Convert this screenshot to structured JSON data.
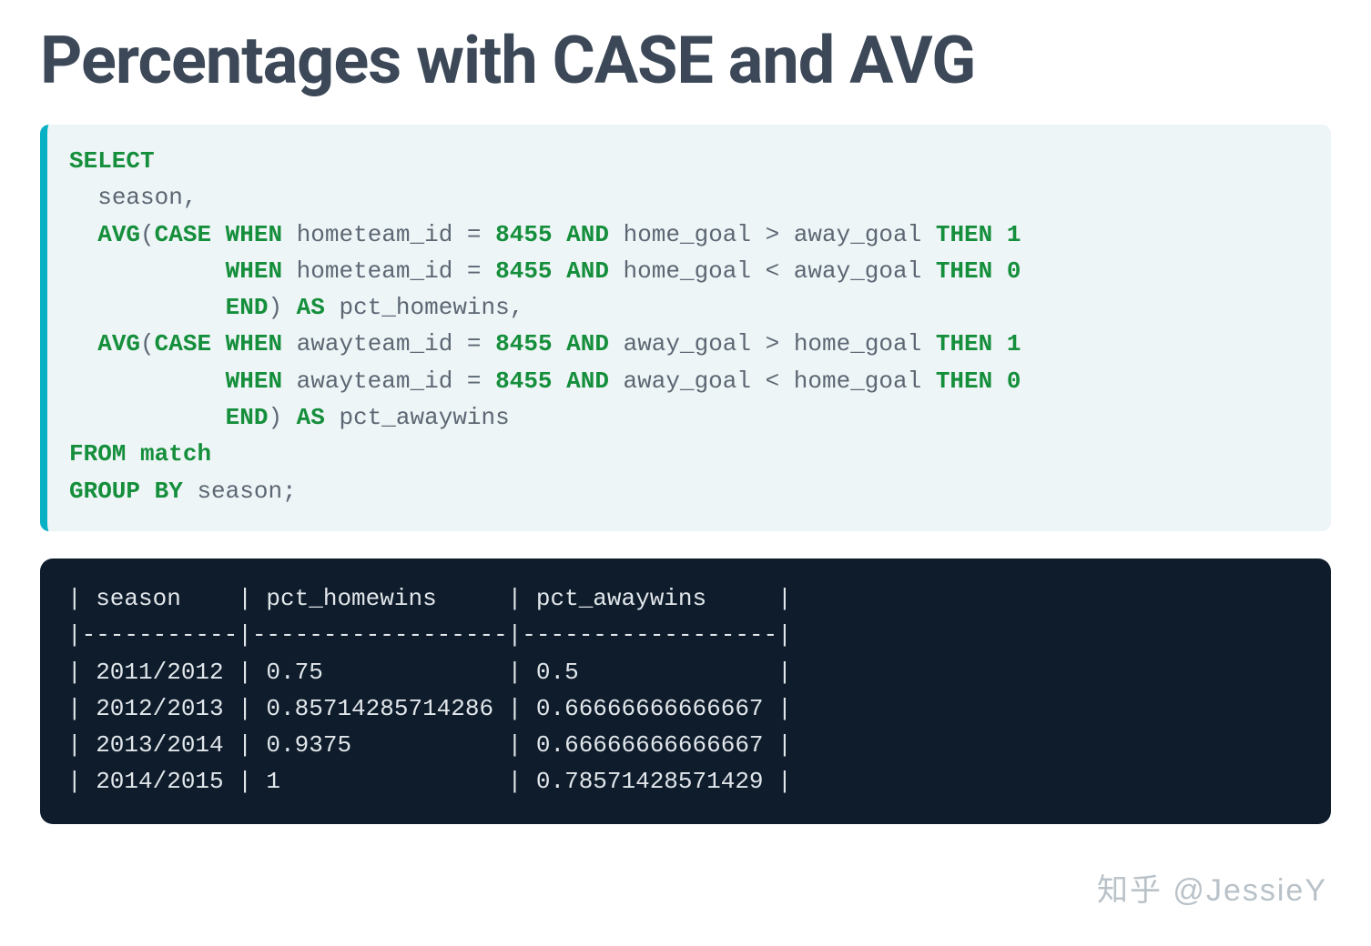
{
  "title": "Percentages with CASE and AVG",
  "sql": {
    "kw_select": "SELECT",
    "line_season": "season,",
    "kw_avg1": "AVG",
    "paren_open1": "(",
    "kw_case1": "CASE",
    "kw_when1a": "WHEN",
    "home_cond_a": "hometeam_id = ",
    "val_8455_a": "8455",
    "kw_and1a": "AND",
    "home_gt": " home_goal > away_goal ",
    "kw_then1a": "THEN",
    "val_1a": "1",
    "kw_when1b": "WHEN",
    "home_cond_b": "hometeam_id = ",
    "val_8455_b": "8455",
    "kw_and1b": "AND",
    "home_lt": " home_goal < away_goal ",
    "kw_then1b": "THEN",
    "val_0b": "0",
    "kw_end1": "END",
    "paren_close1": ")",
    "kw_as1": "AS",
    "alias1": "pct_homewins,",
    "kw_avg2": "AVG",
    "paren_open2": "(",
    "kw_case2": "CASE",
    "kw_when2a": "WHEN",
    "away_cond_a": "awayteam_id = ",
    "val_8455_c": "8455",
    "kw_and2a": "AND",
    "away_gt": " away_goal > home_goal ",
    "kw_then2a": "THEN",
    "val_1c": "1",
    "kw_when2b": "WHEN",
    "away_cond_b": "awayteam_id = ",
    "val_8455_d": "8455",
    "kw_and2b": "AND",
    "away_lt": " away_goal < home_goal ",
    "kw_then2b": "THEN",
    "val_0d": "0",
    "kw_end2": "END",
    "paren_close2": ")",
    "kw_as2": "AS",
    "alias2": "pct_awaywins",
    "kw_from": "FROM",
    "table": "match",
    "kw_groupby": "GROUP BY",
    "group_col": "season;"
  },
  "result": {
    "header": "| season    | pct_homewins     | pct_awaywins     |",
    "divider": "|-----------|------------------|------------------|",
    "rows": [
      "| 2011/2012 | 0.75             | 0.5              |",
      "| 2012/2013 | 0.85714285714286 | 0.66666666666667 |",
      "| 2013/2014 | 0.9375           | 0.66666666666667 |",
      "| 2014/2015 | 1                | 0.78571428571429 |"
    ]
  },
  "watermark": "知乎 @JessieY"
}
